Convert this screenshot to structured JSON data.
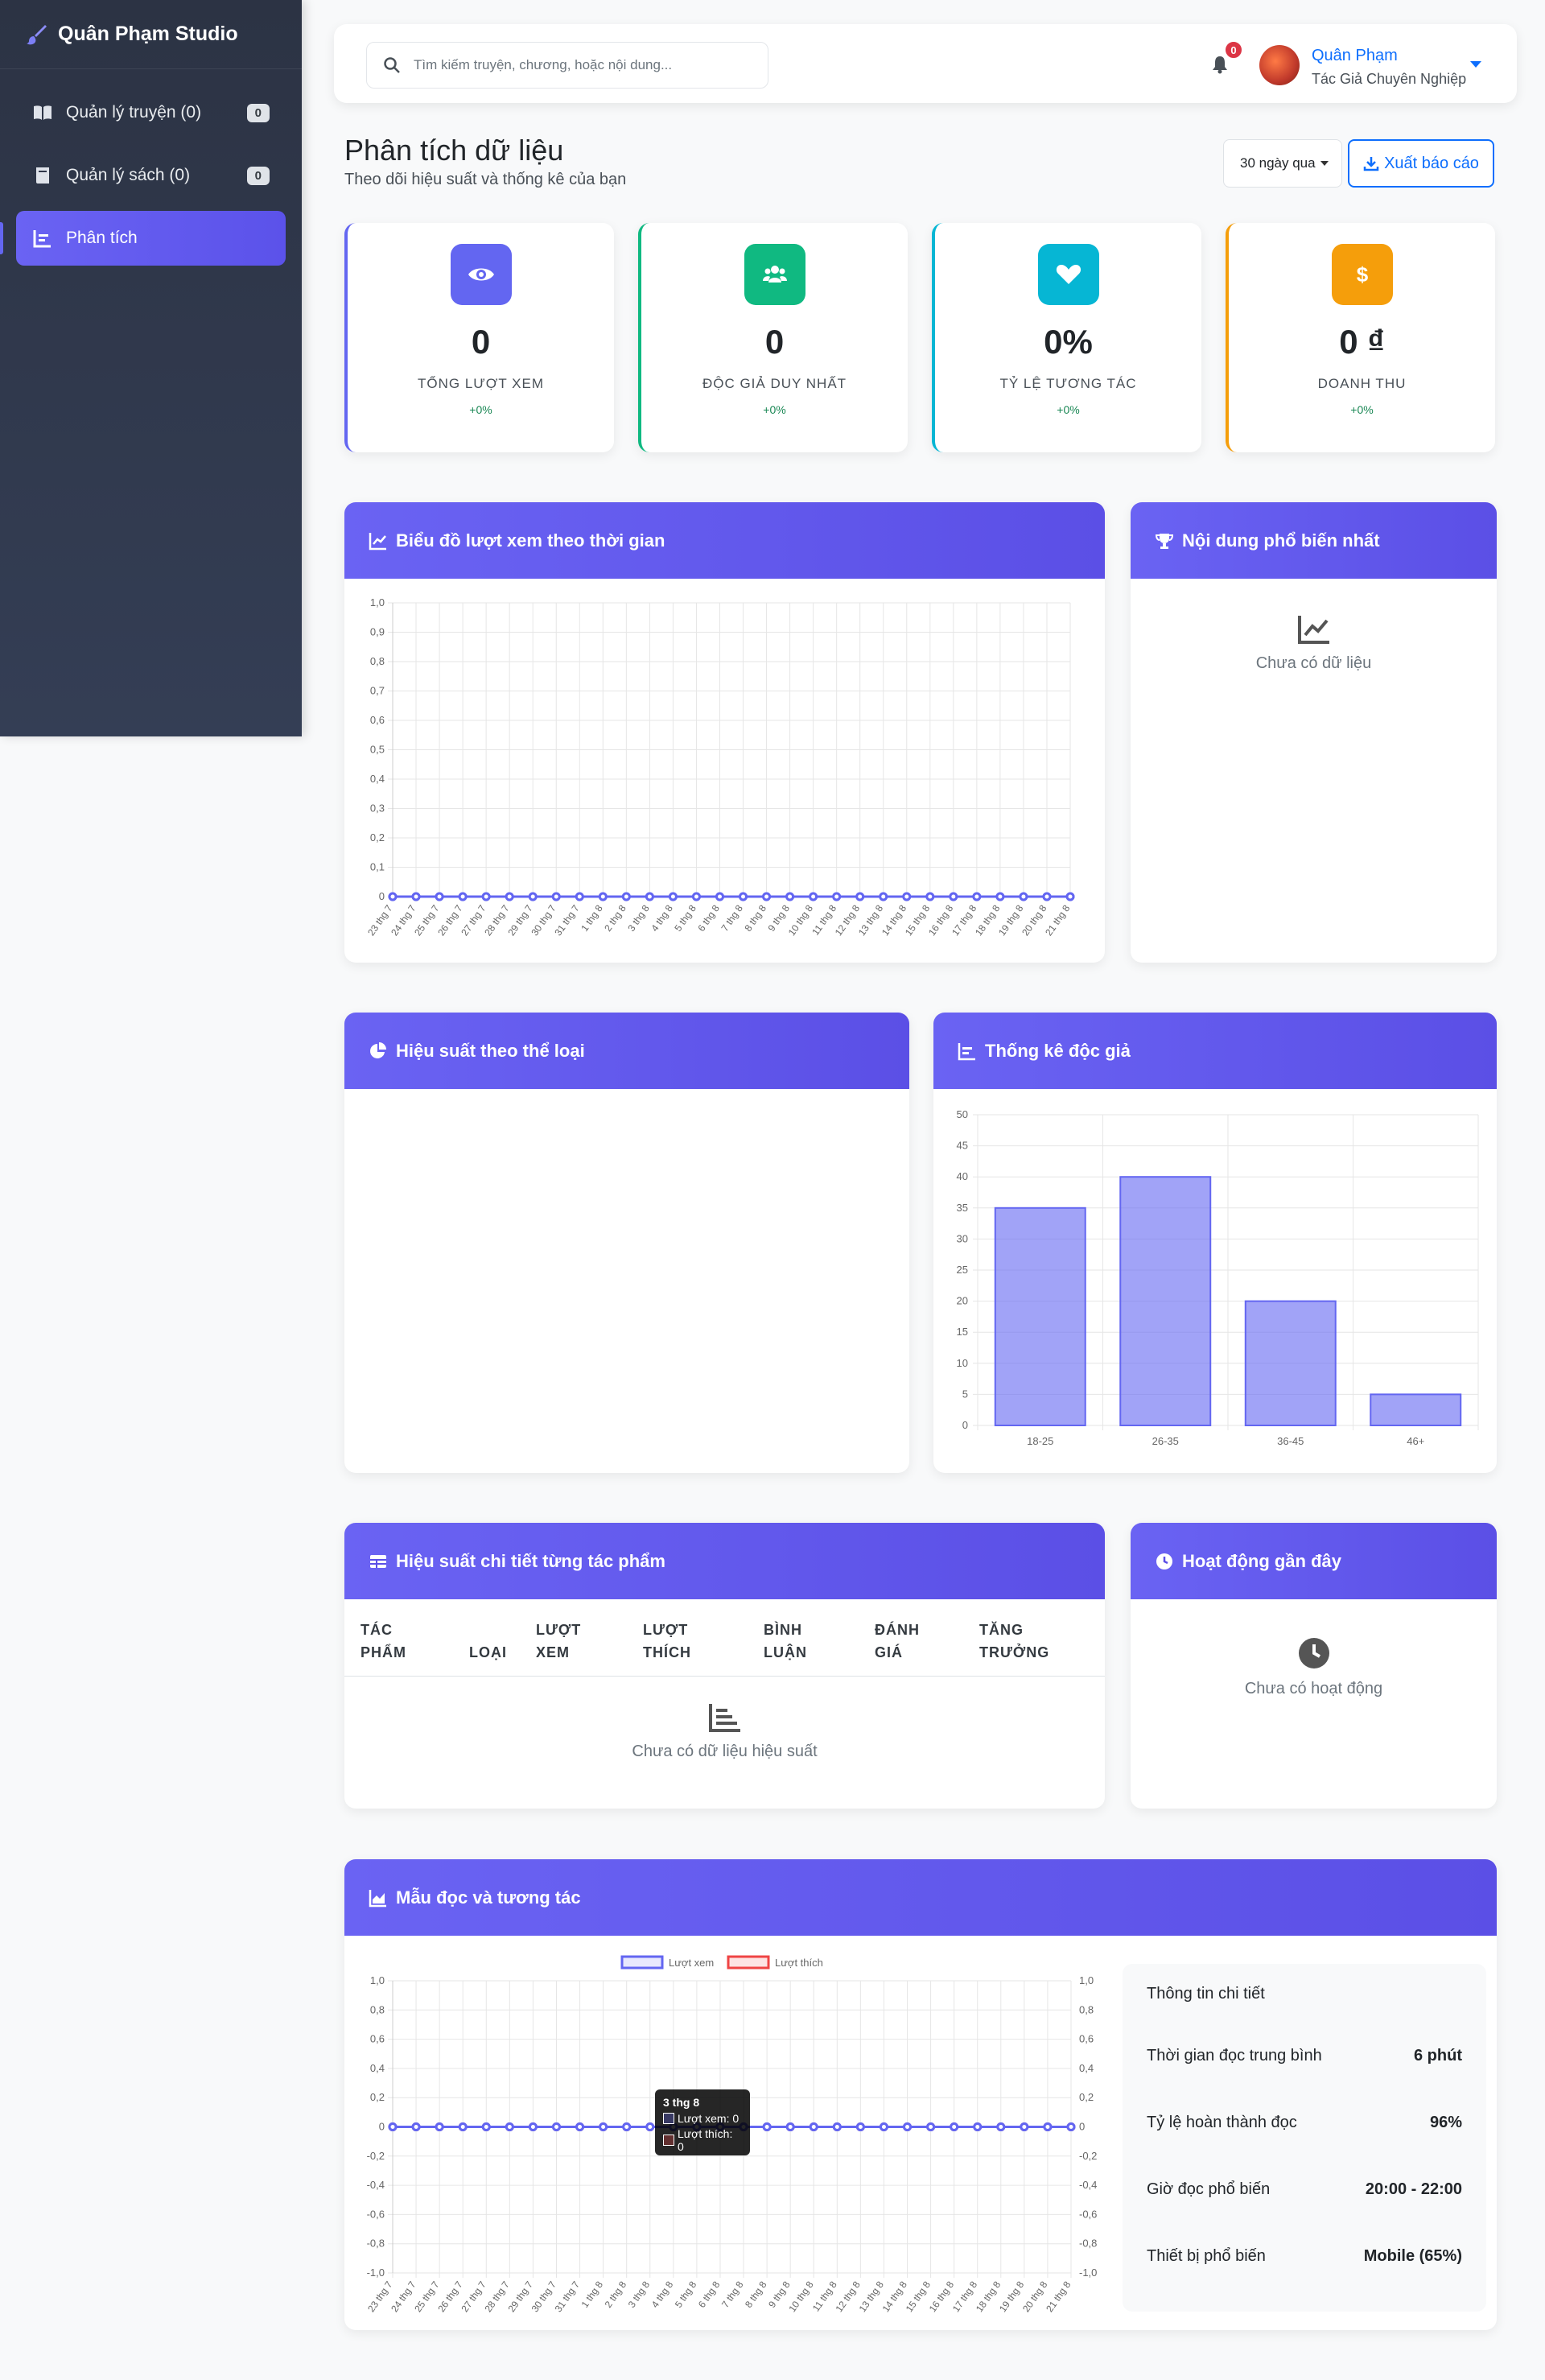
{
  "sidebar": {
    "brand": "Quân Phạm Studio",
    "items": [
      {
        "label": "Quản lý truyện (0)",
        "badge": "0"
      },
      {
        "label": "Quản lý sách (0)",
        "badge": "0"
      },
      {
        "label": "Phân tích"
      }
    ]
  },
  "topbar": {
    "search_placeholder": "Tìm kiếm truyện, chương, hoặc nội dung...",
    "notification_count": "0",
    "user_name": "Quân Phạm",
    "user_role": "Tác Giả Chuyên Nghiệp"
  },
  "page": {
    "title": "Phân tích dữ liệu",
    "subtitle": "Theo dõi hiệu suất và thống kê của bạn",
    "range": "30 ngày qua",
    "export_label": "Xuất báo cáo"
  },
  "stats": [
    {
      "value": "0",
      "label": "Tổng lượt xem",
      "change": "+0%",
      "color": "#6366f1",
      "icon": "eye-icon"
    },
    {
      "value": "0",
      "label": "Độc giả duy nhất",
      "change": "+0%",
      "color": "#10b981",
      "icon": "users-icon"
    },
    {
      "value": "0%",
      "label": "Tỷ lệ tương tác",
      "change": "+0%",
      "color": "#06b6d4",
      "icon": "heart-icon"
    },
    {
      "value": "0 ₫",
      "label": "Doanh thu",
      "change": "+0%",
      "color": "#f59e0b",
      "icon": "dollar-icon"
    }
  ],
  "panels": {
    "views_chart_title": "Biểu đồ lượt xem theo thời gian",
    "popular_title": "Nội dung phổ biến nhất",
    "popular_empty": "Chưa có dữ liệu",
    "genre_title": "Hiệu suất theo thể loại",
    "readers_title": "Thống kê độc giả",
    "works_title": "Hiệu suất chi tiết từng tác phẩm",
    "works_columns": [
      [
        "TÁC",
        "PHẨM"
      ],
      [
        "",
        "LOẠI"
      ],
      [
        "LƯỢT",
        "XEM"
      ],
      [
        "LƯỢT",
        "THÍCH"
      ],
      [
        "BÌNH",
        "LUẬN"
      ],
      [
        "ĐÁNH",
        "GIÁ"
      ],
      [
        "TĂNG",
        "TRƯỞNG"
      ]
    ],
    "works_empty": "Chưa có dữ liệu hiệu suất",
    "activity_title": "Hoạt động gần đây",
    "activity_empty": "Chưa có hoạt động",
    "patterns_title": "Mẫu đọc và tương tác",
    "details_title": "Thông tin chi tiết",
    "details": [
      {
        "label": "Thời gian đọc trung bình",
        "value": "6 phút"
      },
      {
        "label": "Tỷ lệ hoàn thành đọc",
        "value": "96%"
      },
      {
        "label": "Giờ đọc phổ biến",
        "value": "20:00 - 22:00"
      },
      {
        "label": "Thiết bị phổ biến",
        "value": "Mobile (65%)"
      }
    ],
    "tooltip": {
      "title": "3 thg 8",
      "rows": [
        "Lượt xem: 0",
        "Lượt thích: 0"
      ]
    }
  },
  "chart_data": [
    {
      "type": "line",
      "x": [
        "23 thg 7",
        "24 thg 7",
        "25 thg 7",
        "26 thg 7",
        "27 thg 7",
        "28 thg 7",
        "29 thg 7",
        "30 thg 7",
        "31 thg 7",
        "1 thg 8",
        "2 thg 8",
        "3 thg 8",
        "4 thg 8",
        "5 thg 8",
        "6 thg 8",
        "7 thg 8",
        "8 thg 8",
        "9 thg 8",
        "10 thg 8",
        "11 thg 8",
        "12 thg 8",
        "13 thg 8",
        "14 thg 8",
        "15 thg 8",
        "16 thg 8",
        "17 thg 8",
        "18 thg 8",
        "19 thg 8",
        "20 thg 8",
        "21 thg 8"
      ],
      "series": [
        {
          "values": [
            0,
            0,
            0,
            0,
            0,
            0,
            0,
            0,
            0,
            0,
            0,
            0,
            0,
            0,
            0,
            0,
            0,
            0,
            0,
            0,
            0,
            0,
            0,
            0,
            0,
            0,
            0,
            0,
            0,
            0
          ]
        }
      ],
      "yticks": [
        "1,0",
        "0,9",
        "0,8",
        "0,7",
        "0,6",
        "0,5",
        "0,4",
        "0,3",
        "0,2",
        "0,1",
        "0"
      ],
      "ylim": [
        0,
        1
      ],
      "grid": true,
      "color": "#6366f1"
    },
    {
      "type": "bar",
      "categories": [
        "18-25",
        "26-35",
        "36-45",
        "46+"
      ],
      "values": [
        35,
        40,
        20,
        5
      ],
      "yticks": [
        "50",
        "45",
        "40",
        "35",
        "30",
        "25",
        "20",
        "15",
        "10",
        "5",
        "0"
      ],
      "ylim": [
        0,
        50
      ],
      "grid": true,
      "color": "#6366f1"
    },
    {
      "type": "line",
      "x": [
        "23 thg 7",
        "24 thg 7",
        "25 thg 7",
        "26 thg 7",
        "27 thg 7",
        "28 thg 7",
        "29 thg 7",
        "30 thg 7",
        "31 thg 7",
        "1 thg 8",
        "2 thg 8",
        "3 thg 8",
        "4 thg 8",
        "5 thg 8",
        "6 thg 8",
        "7 thg 8",
        "8 thg 8",
        "9 thg 8",
        "10 thg 8",
        "11 thg 8",
        "12 thg 8",
        "13 thg 8",
        "14 thg 8",
        "15 thg 8",
        "16 thg 8",
        "17 thg 8",
        "18 thg 8",
        "19 thg 8",
        "20 thg 8",
        "21 thg 8"
      ],
      "series": [
        {
          "name": "Lượt xem",
          "values": [
            0,
            0,
            0,
            0,
            0,
            0,
            0,
            0,
            0,
            0,
            0,
            0,
            0,
            0,
            0,
            0,
            0,
            0,
            0,
            0,
            0,
            0,
            0,
            0,
            0,
            0,
            0,
            0,
            0,
            0
          ],
          "color": "#6366f1"
        },
        {
          "name": "Lượt thích",
          "values": [
            0,
            0,
            0,
            0,
            0,
            0,
            0,
            0,
            0,
            0,
            0,
            0,
            0,
            0,
            0,
            0,
            0,
            0,
            0,
            0,
            0,
            0,
            0,
            0,
            0,
            0,
            0,
            0,
            0,
            0
          ],
          "color": "#ef4444"
        }
      ],
      "yticks": [
        "1,0",
        "0,8",
        "0,6",
        "0,4",
        "0,2",
        "0",
        "-0,2",
        "-0,4",
        "-0,6",
        "-0,8",
        "-1,0"
      ],
      "ylim": [
        -1,
        1
      ],
      "legend": "top",
      "grid": true
    }
  ]
}
